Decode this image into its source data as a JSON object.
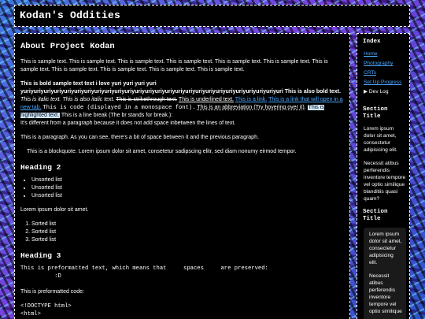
{
  "site": {
    "title": "Kodan's Oddities"
  },
  "main": {
    "heading1": "About Project Kodan",
    "intro": "This is sample text. This is sample text. This is sample text. This is sample text. This is sample text. This is sample text. This is sample text. This is sample text. This is sample text. This is sample text. This is sample text.",
    "bold_text": "This is bold sample text text i love yuri yuri yuri yuri yuriyuriyuriyuriyuriyuriyuriyuriyuriyuriyuriyuriyuriyuriyuriyuriyuriyuriyuriyuriyuriyuriyuriyuriyuriyuri",
    "bold_also": "This is also bold text.",
    "italic1": "This is italic text.",
    "italic2": "This is also italic text.",
    "strike": "This is strikethrough text.",
    "underline": "This is underlined text.",
    "link1": "This is a link.",
    "link2": "This is a link that will open in a new tab.",
    "code": "This is code (displayed in a monospace font).",
    "abbr": "This is an abbreviation (Try hovering over it).",
    "highlight": "This is highlighted text.",
    "linebreak1": "This is a line break (The br stands for break.):",
    "linebreak2": "It's different from a paragraph because it does not add space inbetween the lines of text.",
    "paragraph": "This is a paragraph. As you can see, there's a bit of space between it and the previous paragraph.",
    "blockquote": "This is a blockquote. Lorem ipsum dolor sit amet, consetetur sadipscing elitr, sed diam nonumy eirmod tempor.",
    "heading2": "Heading 2",
    "unsorted": [
      "Unsorted list",
      "Unsorted list",
      "Unsorted list"
    ],
    "lorem": "Lorem ipsum dolor sit amet.",
    "sorted": [
      "Sorted list",
      "Sorted list",
      "Sorted list"
    ],
    "heading3": "Heading 3",
    "pre1": "This is preformatted text, which means that     spaces     are preserved:\n          :D",
    "pre_label": "This is preformatted code:",
    "pre2": "<!DOCTYPE html>\n<html>\n  <body>"
  },
  "sidebar": {
    "index_title": "Index",
    "nav": [
      "Home",
      "Photography",
      "CRTs",
      "Set Up Progress"
    ],
    "dev_log": "Dev Log",
    "section1_title": "Section Title",
    "s1_p1": "Lorem ipsum dolor sit amet, consectetur adipisicing elit.",
    "s1_p2": "Necessit atibus perferendis inventore tempore vel optio similique blanditiis quasi quam?",
    "section2_title": "Section Title",
    "s2_p1": "Lorem ipsum dolor sit amet, consectetur adipisicing elit.",
    "s2_p2": "Necessit atibus perferendis inventore tempore vel optio similique"
  }
}
